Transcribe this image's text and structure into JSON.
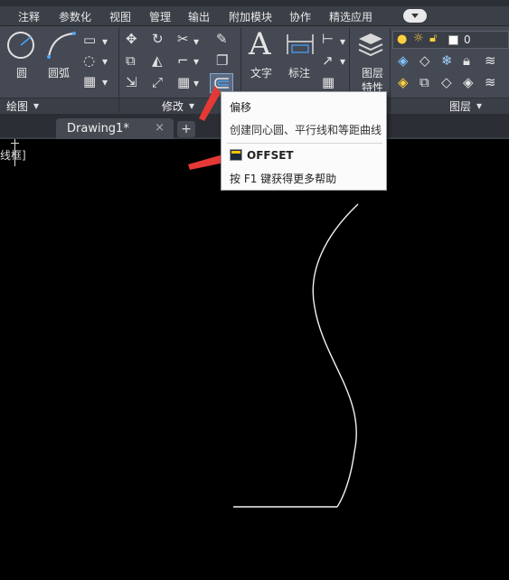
{
  "ribbon_tabs": [
    "注释",
    "参数化",
    "视图",
    "管理",
    "输出",
    "附加模块",
    "协作",
    "精选应用"
  ],
  "draw_panel": {
    "title": "绘图",
    "circle_label": "圆",
    "arc_label": "圆弧"
  },
  "modify_panel": {
    "title": "修改"
  },
  "text_label": "文字",
  "dim_label": "标注",
  "layer_props_label_1": "图层",
  "layer_props_label_2": "特性",
  "layer_panel": {
    "title": "图层",
    "current_layer": "0"
  },
  "doc_tabs": {
    "active": "Drawing1*",
    "close": "×",
    "add": "+"
  },
  "viewport_label": "线框]",
  "tooltip": {
    "title": "偏移",
    "description": "创建同心圆、平行线和等距曲线",
    "command": "OFFSET",
    "help": "按 F1 键获得更多帮助"
  },
  "colors": {
    "annotation_arrow": "#e53935",
    "canvas": "#000000",
    "ribbon": "#444953"
  }
}
